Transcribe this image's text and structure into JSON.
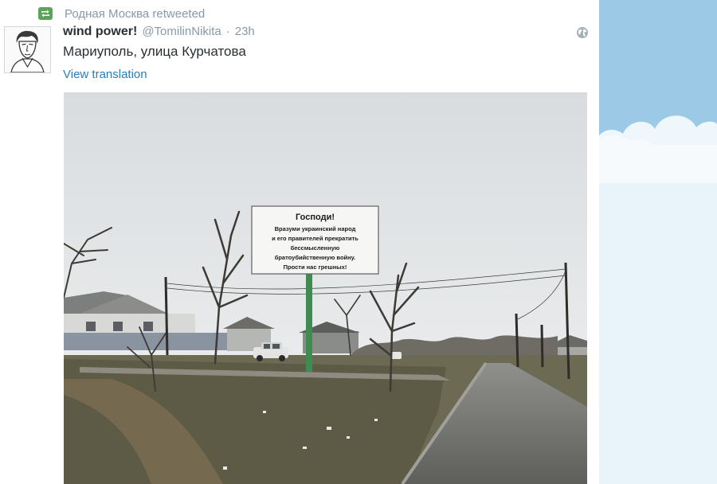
{
  "retweet": {
    "icon": "retweet-icon",
    "label": "Родная Москва retweeted",
    "color": "#5ba35a"
  },
  "tweet": {
    "author_name": "wind power!",
    "author_handle": "@TomilinNikita",
    "separator": "·",
    "timestamp": "23h",
    "text": "Мариуполь, улица Курчатова",
    "translate_link": "View translation",
    "globe_icon": "globe-icon",
    "link_color": "#2b7bb9"
  },
  "photo": {
    "billboard": {
      "title": "Господи!",
      "lines": [
        "Вразуми украинский народ",
        "и его правителей прекратить",
        "бессмысленную",
        "братоубийственную войну.",
        "Прости нас грешных!"
      ]
    }
  },
  "sidebar": {
    "sky_color": "#9cc9e5"
  }
}
